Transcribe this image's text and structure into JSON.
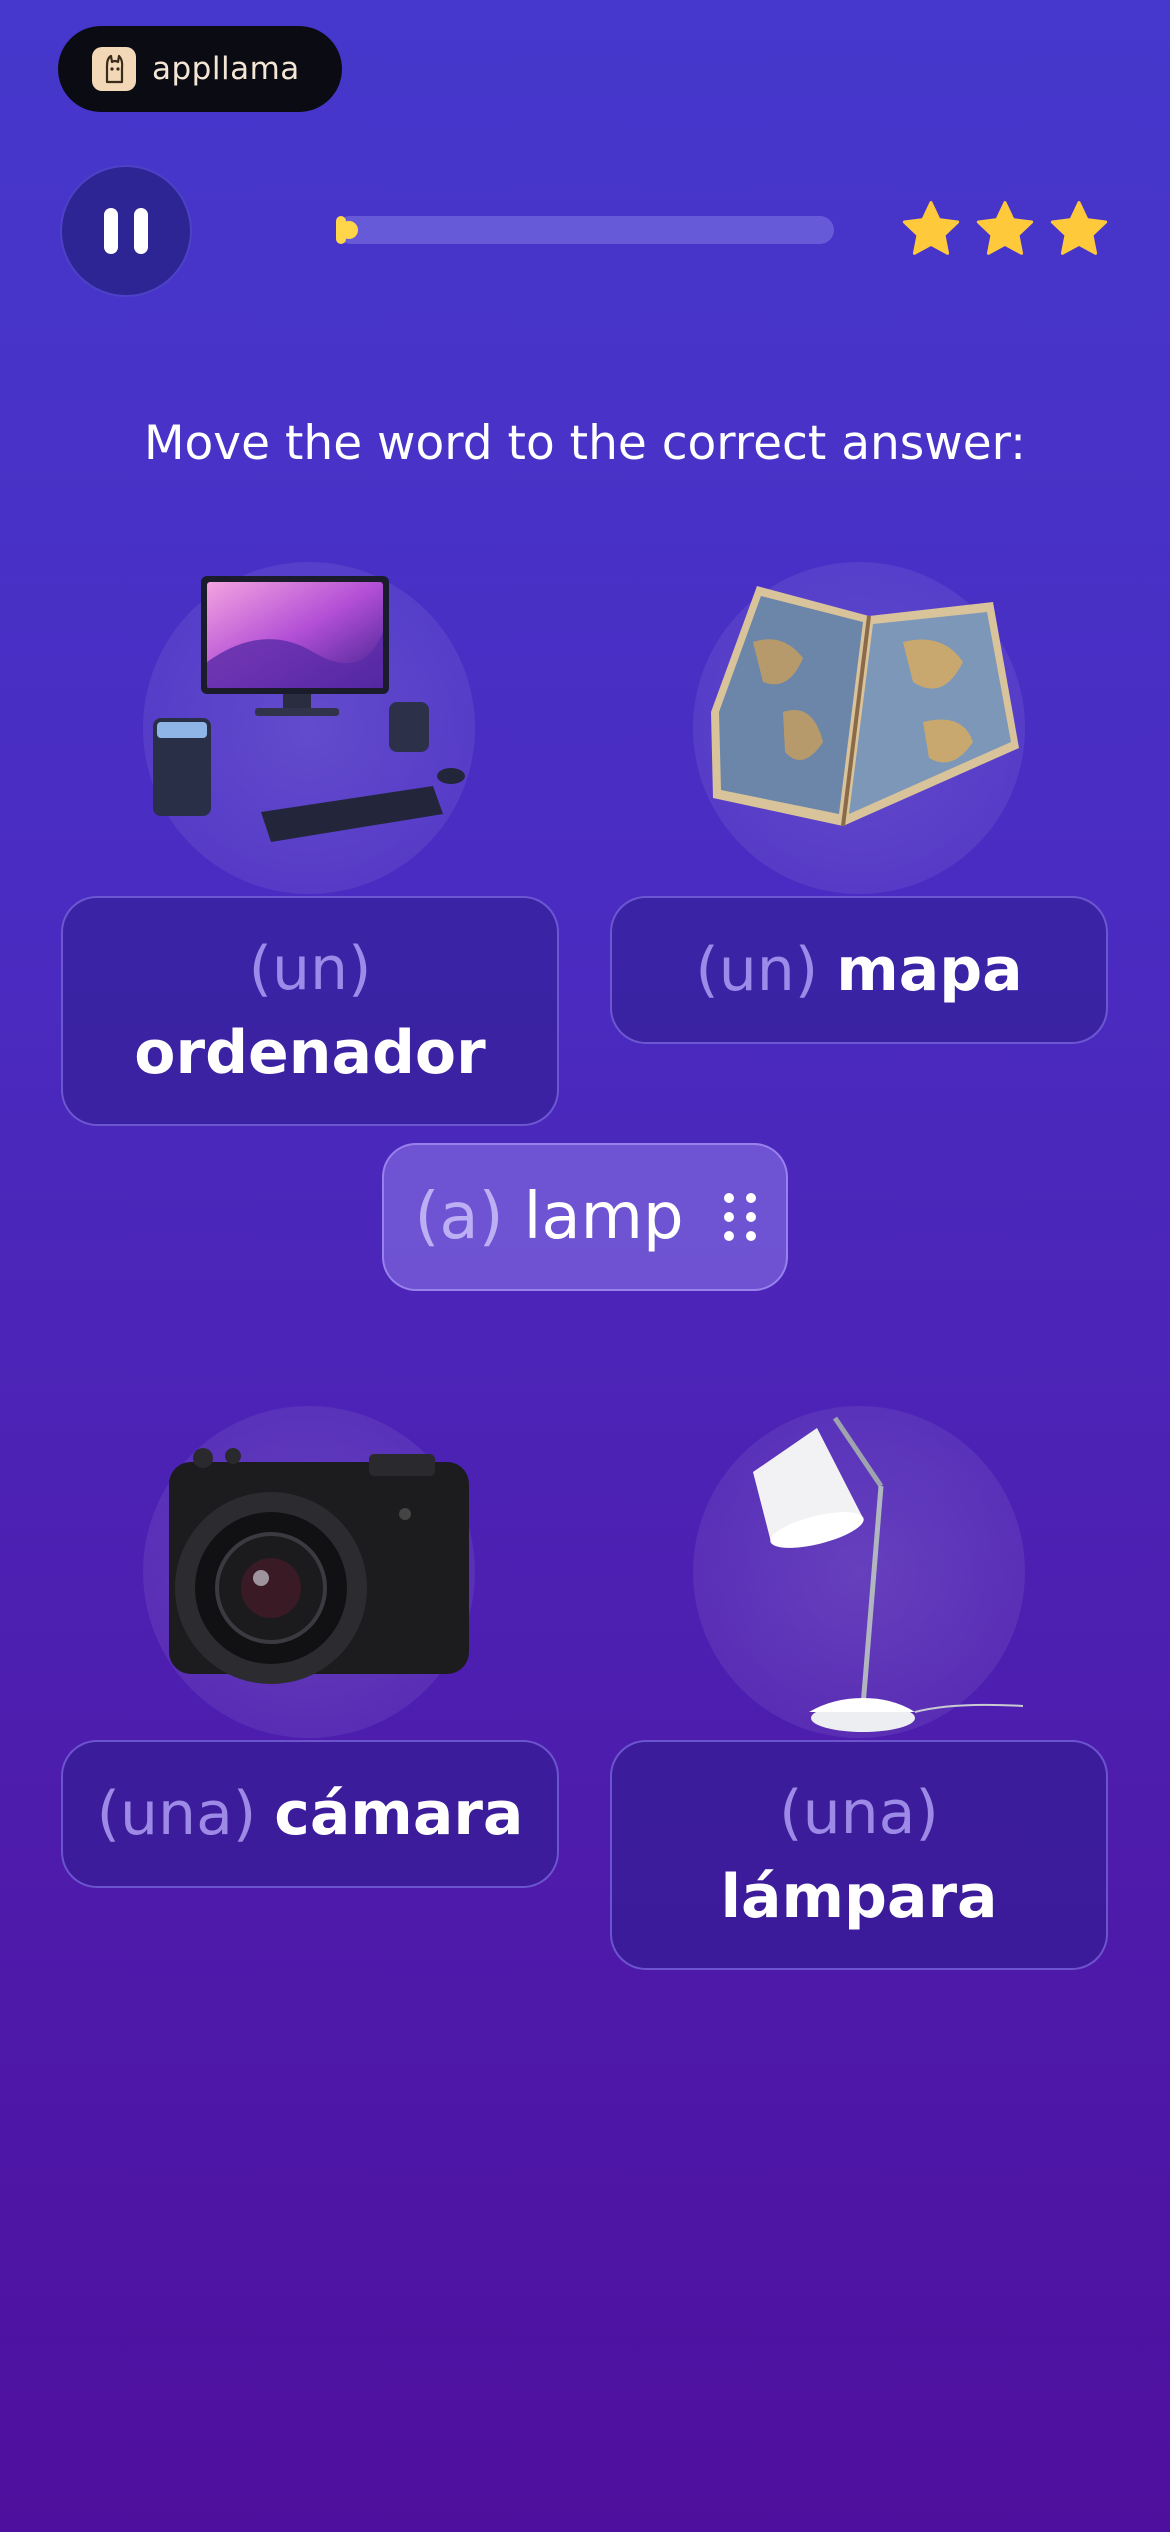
{
  "brand": {
    "name": "appllama",
    "logo_icon": "llama-icon"
  },
  "controls": {
    "pause_icon": "pause-icon"
  },
  "progress": {
    "value": 0.02,
    "color": "#ffd54a"
  },
  "stars": {
    "count": 3,
    "color": "#ffc93c"
  },
  "prompt": "Move the word to the correct answer:",
  "drag_word": {
    "article": "(a)",
    "word": "lamp",
    "handle_icon": "drag-handle-icon"
  },
  "answers": [
    {
      "article": "(un)",
      "word": "ordenador",
      "image": "computer-image"
    },
    {
      "article": "(un)",
      "word": "mapa",
      "image": "map-image"
    },
    {
      "article": "(una)",
      "word": "cámara",
      "image": "camera-image"
    },
    {
      "article": "(una)",
      "word": "lámpara",
      "image": "lamp-image"
    }
  ],
  "colors": {
    "background_top": "#4638cc",
    "background_bottom": "#4f0f9e",
    "accent": "#ffd54a"
  }
}
